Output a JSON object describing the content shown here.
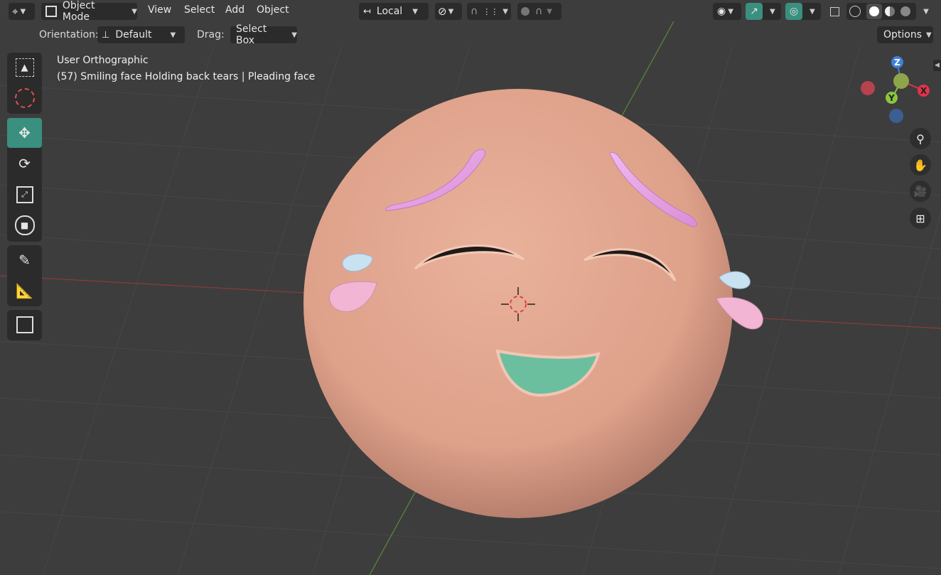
{
  "header": {
    "editor_type_icon": "axes-icon",
    "mode": "Object Mode",
    "menus": [
      "View",
      "Select",
      "Add",
      "Object"
    ],
    "transform_orientation": "Local",
    "snap_icon": "magnet-icon",
    "proportional_icon": "proportional-edit-icon",
    "visibility_icon": "eye-icon",
    "gizmo_icon": "gizmo-icon",
    "overlay_icon": "overlay-icon",
    "xray_icon": "xray-icon",
    "shading_modes": [
      "wireframe",
      "solid",
      "material-preview",
      "rendered"
    ],
    "active_shading": "solid"
  },
  "tool_settings": {
    "orientation_label": "Orientation:",
    "orientation_value": "Default",
    "drag_label": "Drag:",
    "drag_value": "Select Box",
    "options_label": "Options"
  },
  "viewport": {
    "view_name": "User Orthographic",
    "object_info": "(57) Smiling face Holding back tears | Pleading face"
  },
  "toolbar": {
    "tools": [
      "select-box",
      "cursor",
      "move",
      "rotate",
      "scale",
      "transform",
      "annotate",
      "measure",
      "add-cube"
    ],
    "active_tool": "move"
  },
  "gizmo": {
    "x_label": "X",
    "y_label": "Y",
    "z_label": "Z",
    "x_color": "#e0344a",
    "y_color": "#8bc640",
    "z_color": "#3c82d8"
  },
  "nav_buttons": [
    "zoom-icon",
    "hand-icon",
    "camera-icon",
    "grid-icon"
  ],
  "colors": {
    "accent": "#3a8f7e",
    "face": "#e6a98f",
    "eyebrow": "#e9a6e4",
    "tear_blue": "#c9e2f1",
    "tear_pink": "#f2b5d3",
    "mouth": "#6bbf9f"
  }
}
